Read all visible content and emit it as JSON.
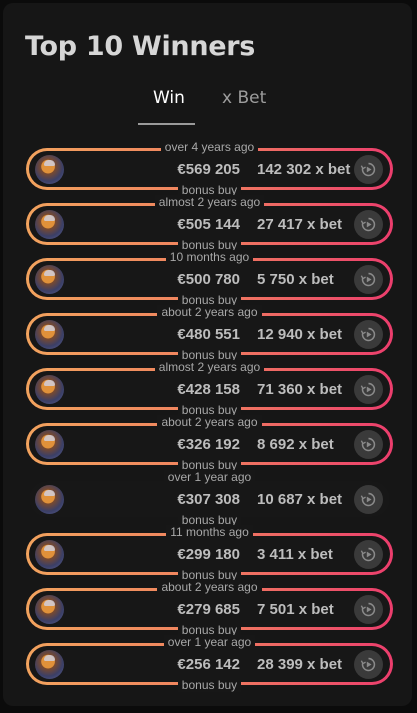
{
  "title": "Top 10 Winners",
  "tabs": [
    {
      "label": "Win",
      "active": true
    },
    {
      "label": "x Bet",
      "active": false
    }
  ],
  "accent_gradient": [
    "#f2a35e",
    "#ec3d6d"
  ],
  "icons": {
    "avatar": "player-avatar",
    "replay": "replay-icon"
  },
  "winners": [
    {
      "time": "over 4 years ago",
      "amount": "€569 205",
      "multiplier": "142 302 x bet",
      "type": "bonus buy",
      "highlighted": true
    },
    {
      "time": "almost 2 years ago",
      "amount": "€505 144",
      "multiplier": "27 417 x bet",
      "type": "bonus buy",
      "highlighted": true
    },
    {
      "time": "10 months ago",
      "amount": "€500 780",
      "multiplier": "5 750 x bet",
      "type": "bonus buy",
      "highlighted": true
    },
    {
      "time": "about 2 years ago",
      "amount": "€480 551",
      "multiplier": "12 940 x bet",
      "type": "bonus buy",
      "highlighted": true
    },
    {
      "time": "almost 2 years ago",
      "amount": "€428 158",
      "multiplier": "71 360 x bet",
      "type": "bonus buy",
      "highlighted": true
    },
    {
      "time": "about 2 years ago",
      "amount": "€326 192",
      "multiplier": "8 692 x bet",
      "type": "bonus buy",
      "highlighted": true
    },
    {
      "time": "over 1 year ago",
      "amount": "€307 308",
      "multiplier": "10 687 x bet",
      "type": "bonus buy",
      "highlighted": false
    },
    {
      "time": "11 months ago",
      "amount": "€299 180",
      "multiplier": "3 411 x bet",
      "type": "bonus buy",
      "highlighted": true
    },
    {
      "time": "about 2 years ago",
      "amount": "€279 685",
      "multiplier": "7 501 x bet",
      "type": "bonus buy",
      "highlighted": true
    },
    {
      "time": "over 1 year ago",
      "amount": "€256 142",
      "multiplier": "28 399 x bet",
      "type": "bonus buy",
      "highlighted": true
    }
  ]
}
